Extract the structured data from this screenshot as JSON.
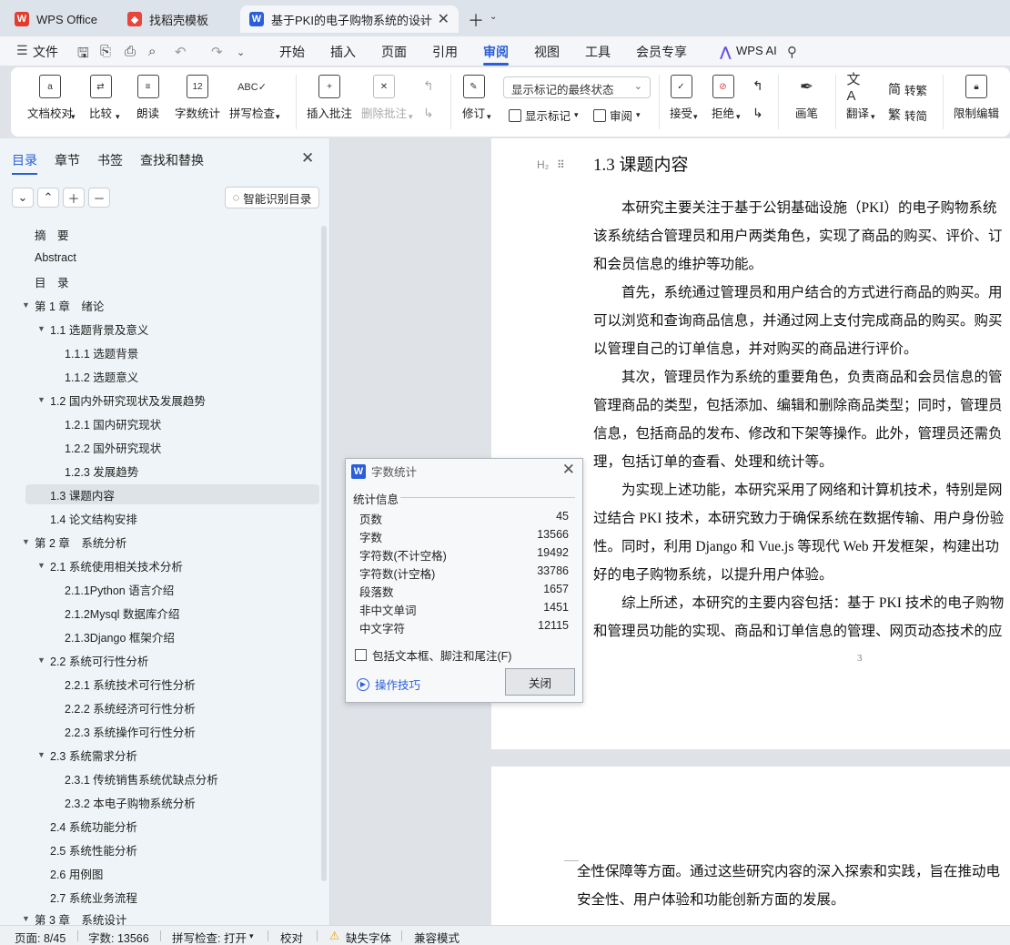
{
  "tabs": [
    {
      "label": "WPS Office"
    },
    {
      "label": "找稻壳模板"
    },
    {
      "label": "基于PKI的电子购物系统的设计"
    }
  ],
  "menu": [
    "文件",
    "开始",
    "插入",
    "页面",
    "引用",
    "审阅",
    "视图",
    "工具",
    "会员专享",
    "WPS AI"
  ],
  "ribbon": {
    "doc_check": "文档校对",
    "compare": "比较",
    "read_aloud": "朗读",
    "word_count": "字数统计",
    "spell_check": "拼写检查",
    "insert_comment": "插入批注",
    "delete_comment": "删除批注",
    "revise": "修订",
    "markup_select": "显示标记的最终状态",
    "show_markup": "显示标记",
    "review": "审阅",
    "accept": "接受",
    "reject": "拒绝",
    "pen": "画笔",
    "translate": "翻译",
    "to_traditional": "转繁",
    "to_simplified": "转简",
    "restrict_edit": "限制编辑"
  },
  "left_panel": {
    "tabs": [
      "目录",
      "章节",
      "书签",
      "查找和替换"
    ],
    "smart_toc": "智能识别目录",
    "toc": [
      {
        "label": "摘　要"
      },
      {
        "label": "Abstract"
      },
      {
        "label": "目　录"
      },
      {
        "label": "第 1 章　绪论"
      },
      {
        "label": "1.1  选题背景及意义"
      },
      {
        "label": "1.1.1  选题背景"
      },
      {
        "label": "1.1.2  选题意义"
      },
      {
        "label": "1.2  国内外研究现状及发展趋势"
      },
      {
        "label": "1.2.1  国内研究现状"
      },
      {
        "label": "1.2.2  国外研究现状"
      },
      {
        "label": "1.2.3  发展趋势"
      },
      {
        "label": "1.3 课题内容"
      },
      {
        "label": "1.4 论文结构安排"
      },
      {
        "label": "第 2 章　系统分析"
      },
      {
        "label": "2.1 系统使用相关技术分析"
      },
      {
        "label": "2.1.1Python 语言介绍"
      },
      {
        "label": "2.1.2Mysql 数据库介绍"
      },
      {
        "label": "2.1.3Django 框架介绍"
      },
      {
        "label": "2.2 系统可行性分析"
      },
      {
        "label": "2.2.1 系统技术可行性分析"
      },
      {
        "label": "2.2.2 系统经济可行性分析"
      },
      {
        "label": "2.2.3 系统操作可行性分析"
      },
      {
        "label": "2.3 系统需求分析"
      },
      {
        "label": "2.3.1 传统销售系统优缺点分析"
      },
      {
        "label": "2.3.2 本电子购物系统分析"
      },
      {
        "label": "2.4 系统功能分析"
      },
      {
        "label": "2.5 系统性能分析"
      },
      {
        "label": "2.6 用例图"
      },
      {
        "label": "2.7 系统业务流程"
      },
      {
        "label": "第 3 章　系统设计"
      }
    ]
  },
  "document": {
    "heading_marker": "H₂",
    "heading": "1.3 课题内容",
    "lines": [
      "　　本研究主要关注于基于公钥基础设施（PKI）的电子购物系统",
      "该系统结合管理员和用户两类角色，实现了商品的购买、评价、订",
      "和会员信息的维护等功能。",
      "　　首先，系统通过管理员和用户结合的方式进行商品的购买。用",
      "可以浏览和查询商品信息，并通过网上支付完成商品的购买。购买",
      "以管理自己的订单信息，并对购买的商品进行评价。",
      "　　其次，管理员作为系统的重要角色，负责商品和会员信息的管",
      "管理商品的类型，包括添加、编辑和删除商品类型；同时，管理员",
      "信息，包括商品的发布、修改和下架等操作。此外，管理员还需负",
      "理，包括订单的查看、处理和统计等。",
      "　　为实现上述功能，本研究采用了网络和计算机技术，特别是网",
      "过结合 PKI 技术，本研究致力于确保系统在数据传输、用户身份验",
      "性。同时，利用 Django 和 Vue.js 等现代 Web 开发框架，构建出功",
      "好的电子购物系统，以提升用户体验。",
      "　　综上所述，本研究的主要内容包括：基于 PKI 技术的电子购物",
      "和管理员功能的实现、商品和订单信息的管理、网页动态技术的应"
    ],
    "page_number": "3",
    "page2_lines": [
      "全性保障等方面。通过这些研究内容的深入探索和实践，旨在推动电",
      "安全性、用户体验和功能创新方面的发展。"
    ]
  },
  "dialog": {
    "title": "字数统计",
    "group": "统计信息",
    "stats": [
      {
        "label": "页数",
        "value": "45"
      },
      {
        "label": "字数",
        "value": "13566"
      },
      {
        "label": "字符数(不计空格)",
        "value": "19492"
      },
      {
        "label": "字符数(计空格)",
        "value": "33786"
      },
      {
        "label": "段落数",
        "value": "1657"
      },
      {
        "label": "非中文单词",
        "value": "1451"
      },
      {
        "label": "中文字符",
        "value": "12115"
      }
    ],
    "checkbox": "包括文本框、脚注和尾注(F)",
    "tips": "操作技巧",
    "close": "关闭"
  },
  "status": {
    "page": "页面: 8/45",
    "words": "字数: 13566",
    "spell": "拼写检查: 打开",
    "proof": "校对",
    "missing_font": "缺失字体",
    "compat": "兼容模式"
  }
}
